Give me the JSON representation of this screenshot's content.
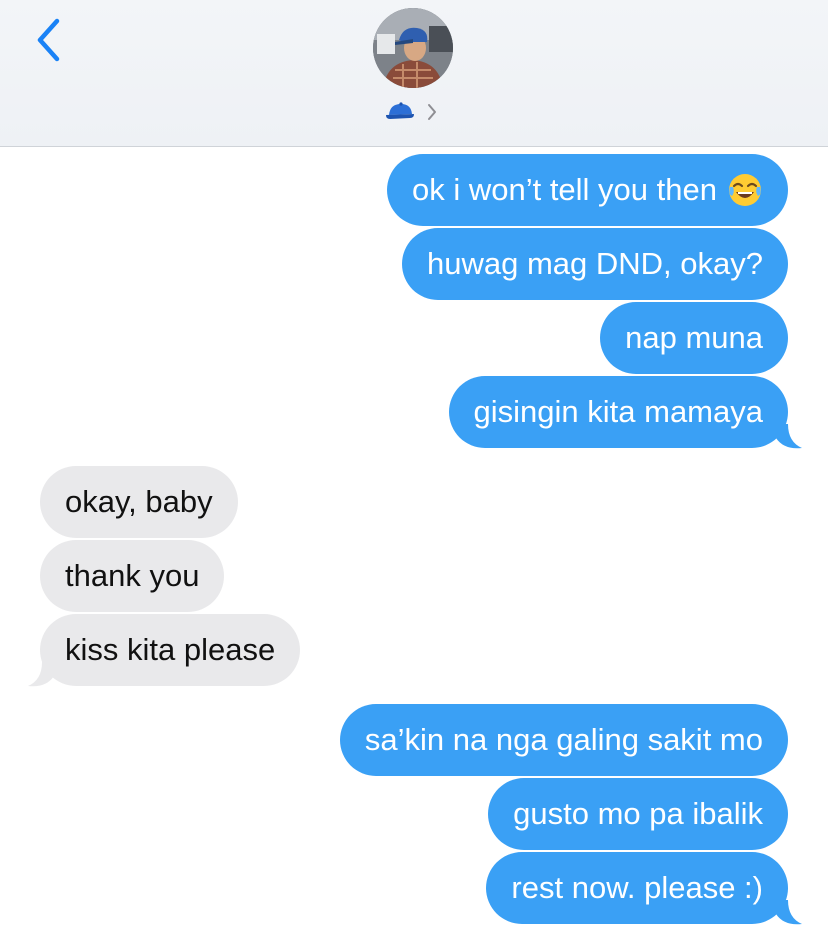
{
  "header": {
    "back_icon": "chevron-left-icon",
    "contact_icon": "blue-cap-icon",
    "disclosure_icon": "chevron-right-icon"
  },
  "messages": [
    {
      "direction": "outgoing",
      "text": "ok i won’t tell you then",
      "emoji": "face-with-tears-of-joy"
    },
    {
      "direction": "outgoing",
      "text": "huwag mag DND, okay?"
    },
    {
      "direction": "outgoing",
      "text": "nap muna"
    },
    {
      "direction": "outgoing",
      "text": "gisingin kita mamaya"
    },
    {
      "direction": "incoming",
      "text": "okay, baby"
    },
    {
      "direction": "incoming",
      "text": "thank you"
    },
    {
      "direction": "incoming",
      "text": "kiss kita please"
    },
    {
      "direction": "outgoing",
      "text": "sa’kin na nga galing sakit mo"
    },
    {
      "direction": "outgoing",
      "text": "gusto mo pa ibalik"
    },
    {
      "direction": "outgoing",
      "text": "rest now. please :)"
    }
  ],
  "colors": {
    "outgoing_bubble": "#3aa0f5",
    "incoming_bubble": "#e9e9eb",
    "accent": "#1a82f6"
  }
}
